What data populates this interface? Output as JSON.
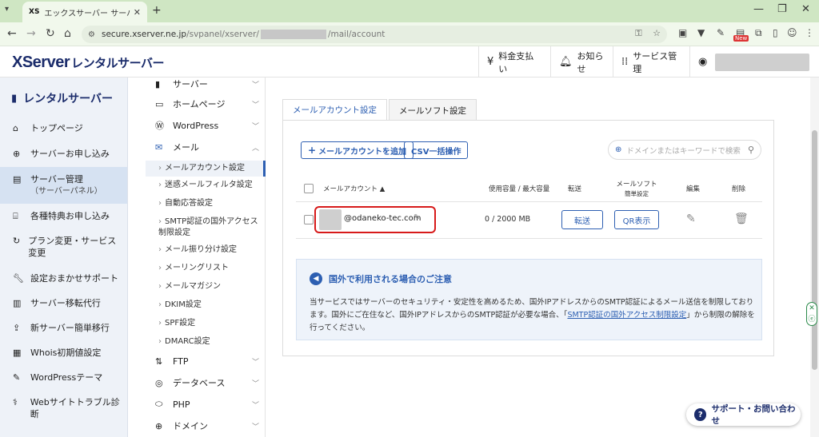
{
  "browser": {
    "tab_favicon": "XS",
    "tab_title": "エックスサーバー サーバーパネル - メ",
    "url_prefix": "secure.xserver.ne.jp",
    "url_path1": "/svpanel/xserver/",
    "url_path2": "/mail/account",
    "ext_new_badge": "New"
  },
  "header": {
    "logo_main": "XServer",
    "logo_sub": "レンタルサーバー",
    "payment": "料金支払い",
    "notices": "お知らせ",
    "services": "サービス管理"
  },
  "sidebar": {
    "title": "レンタルサーバー",
    "items": [
      {
        "label": "トップページ",
        "icon": "home-icon"
      },
      {
        "label": "サーバーお申し込み",
        "icon": "plus-icon"
      },
      {
        "label": "サーバー管理",
        "sub": "（サーバーパネル）",
        "icon": "server-icon"
      },
      {
        "label": "各種特典お申し込み",
        "icon": "gift-icon"
      },
      {
        "label": "プラン変更・サービス変更",
        "icon": "refresh-icon"
      },
      {
        "label": "設定おまかせサポート",
        "icon": "wrench-icon"
      },
      {
        "label": "サーバー移転代行",
        "icon": "server-move-icon"
      },
      {
        "label": "新サーバー簡単移行",
        "icon": "upload-icon"
      },
      {
        "label": "Whois初期値設定",
        "icon": "whois-icon"
      },
      {
        "label": "WordPressテーマ",
        "icon": "wordpress-theme-icon"
      },
      {
        "label": "Webサイトトラブル診断",
        "icon": "diagnose-icon"
      }
    ]
  },
  "menu2": {
    "sections": {
      "server": "サーバー",
      "homepage": "ホームページ",
      "wordpress": "WordPress",
      "mail": "メール",
      "ftp": "FTP",
      "database": "データベース",
      "php": "PHP",
      "domain": "ドメイン"
    },
    "mail_items": [
      "メールアカウント設定",
      "迷惑メールフィルタ設定",
      "自動応答設定",
      "SMTP認証の国外アクセス制限設定",
      "メール振り分け設定",
      "メーリングリスト",
      "メールマガジン",
      "DKIM設定",
      "SPF設定",
      "DMARC設定"
    ]
  },
  "main": {
    "tabs": [
      "メールアカウント設定",
      "メールソフト設定"
    ],
    "add_button": "メールアカウントを追加",
    "csv_button": "CSV一括操作",
    "search_placeholder": "ドメインまたはキーワードで検索",
    "columns": {
      "account": "メールアカウント",
      "sort_mark": "▲",
      "usage_used": "使用容量",
      "usage_sep": "/",
      "usage_max": "最大容量",
      "forward": "転送",
      "mailsoft_l1": "メールソフト",
      "mailsoft_l2": "簡単設定",
      "edit": "編集",
      "delete": "削除"
    },
    "row": {
      "domain": "@odaneko-tec.com",
      "usage": "0 / 2000 MB",
      "forward_button": "転送",
      "qr_button": "QR表示"
    },
    "notice": {
      "title": "国外で利用される場合のご注意",
      "body_before": "当サービスではサーバーのセキュリティ・安定性を高めるため、国外IPアドレスからのSMTP認証によるメール送信を制限しております。国外にご在住など、国外IPアドレスからのSMTP認証が必要な場合、「",
      "body_link": "SMTP認証の国外アクセス制限設定",
      "body_after": "」から制限の解除を行ってください。"
    }
  },
  "support": {
    "label": "サポート・お問い合わせ"
  }
}
